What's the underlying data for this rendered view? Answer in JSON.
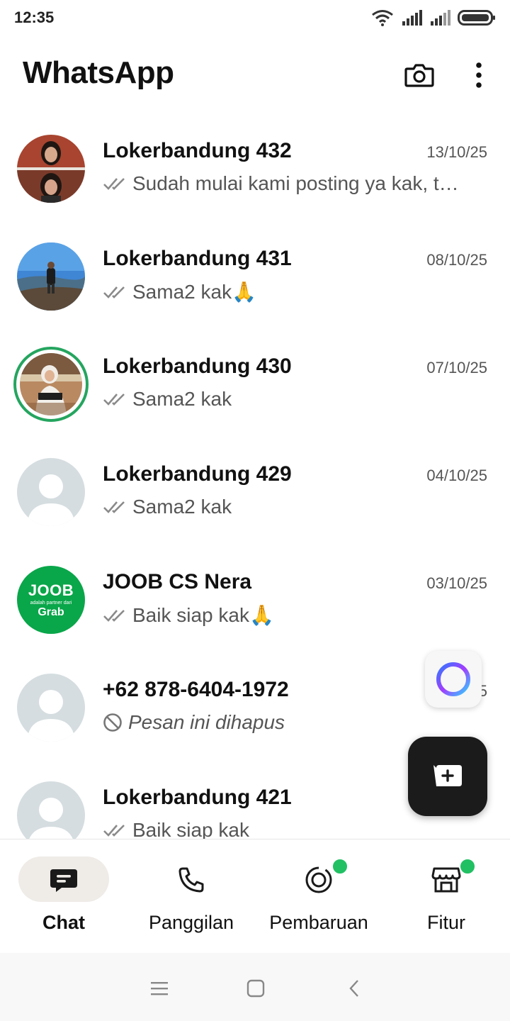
{
  "status_bar": {
    "time": "12:35"
  },
  "header": {
    "title": "WhatsApp"
  },
  "chats": [
    {
      "name": "Lokerbandung 432",
      "date": "13/10/25",
      "preview": "Sudah mulai kami posting ya kak, t…",
      "avatar": "photo-duo"
    },
    {
      "name": "Lokerbandung 431",
      "date": "08/10/25",
      "preview": "Sama2 kak🙏",
      "avatar": "photo-landscape"
    },
    {
      "name": "Lokerbandung 430",
      "date": "07/10/25",
      "preview": "Sama2 kak",
      "avatar": "photo-status"
    },
    {
      "name": "Lokerbandung 429",
      "date": "04/10/25",
      "preview": "Sama2 kak",
      "avatar": "default"
    },
    {
      "name": "JOOB CS Nera",
      "date": "03/10/25",
      "preview": "Baik siap kak🙏",
      "avatar": "joob-logo"
    },
    {
      "name": "+62 878-6404-1972",
      "date": "2…5",
      "preview": "Pesan ini dihapus",
      "avatar": "default"
    },
    {
      "name": "Lokerbandung 421",
      "date": "",
      "preview": "Baik siap kak",
      "avatar": "default"
    }
  ],
  "joob_logo": {
    "title": "JOOB",
    "sub": "adalah partner dari",
    "brand": "Grab"
  },
  "nav": {
    "chat": "Chat",
    "calls": "Panggilan",
    "updates": "Pembaruan",
    "tools": "Fitur"
  },
  "colors": {
    "accent_green": "#21c063",
    "ring_green": "#25a55f",
    "joob_green": "#0aa64a",
    "fab_bg": "#1b1b1b"
  }
}
